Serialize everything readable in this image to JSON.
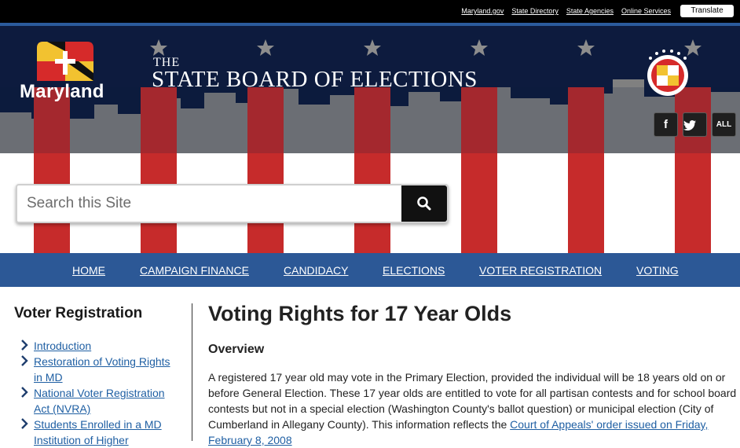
{
  "topbar": {
    "links": [
      "Maryland.gov",
      "State Directory",
      "State Agencies",
      "Online Services"
    ],
    "translate_label": "Translate"
  },
  "header": {
    "logo_text": "Maryland",
    "title_small": "THE",
    "title": "STATE BOARD OF ELECTIONS",
    "social": {
      "facebook": "f",
      "twitter": "twitter-icon",
      "all": "ALL"
    }
  },
  "search": {
    "placeholder": "Search this Site",
    "value": ""
  },
  "nav": {
    "items": [
      "HOME",
      "CAMPAIGN FINANCE",
      "CANDIDACY",
      "ELECTIONS",
      "VOTER REGISTRATION",
      "VOTING"
    ]
  },
  "sidebar": {
    "title": "Voter Registration",
    "items": [
      "Introduction",
      "Restoration of Voting Rights in MD",
      "National Voter Registration Act (NVRA)",
      "Students Enrolled in a MD Institution of Higher"
    ]
  },
  "main": {
    "title": "Voting Rights for 17 Year Olds",
    "section": "Overview",
    "paragraph": "A registered 17 year old may vote in the Primary Election, provided the individual will be 18 years old on or before General Election. These 17 year olds are entitled to vote for all partisan contests and for school board contests but not in a special election (Washington County's ballot question) or municipal election (City of Cumberland in Allegany County). This information reflects the",
    "link": "Court of Appeals' order issued on Friday, February 8, 2008"
  },
  "colors": {
    "navy": "#0d1b3e",
    "nav_blue": "#2c5896",
    "stripe_red": "#c62b2b",
    "link_blue": "#1f5fa3"
  }
}
